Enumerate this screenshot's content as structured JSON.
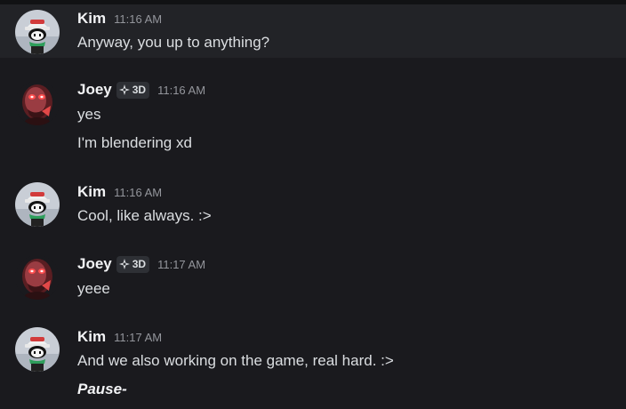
{
  "messages": [
    {
      "author": "Kim",
      "time": "11:16 AM",
      "lines": [
        "Anyway, you up to anything?"
      ]
    },
    {
      "author": "Joey",
      "tag": "3D",
      "time": "11:16 AM",
      "lines": [
        "yes",
        "I'm blendering xd"
      ]
    },
    {
      "author": "Kim",
      "time": "11:16 AM",
      "lines": [
        "Cool, like always. :>"
      ]
    },
    {
      "author": "Joey",
      "tag": "3D",
      "time": "11:17 AM",
      "lines": [
        "yeee"
      ]
    },
    {
      "author": "Kim",
      "time": "11:17 AM",
      "lines": [
        "And we also working on the game, real hard. :>",
        "Pause-"
      ]
    }
  ],
  "icons": {
    "kim_avatar": "avatar-kim-icon",
    "joey_avatar": "avatar-joey-icon",
    "tag_icon": "sparkle-diamond-icon"
  },
  "colors": {
    "background": "#1a1a1e",
    "highlight_row": "#222327",
    "username": "#f2f3f5",
    "timestamp": "#94969c",
    "text": "#dbdee1"
  }
}
